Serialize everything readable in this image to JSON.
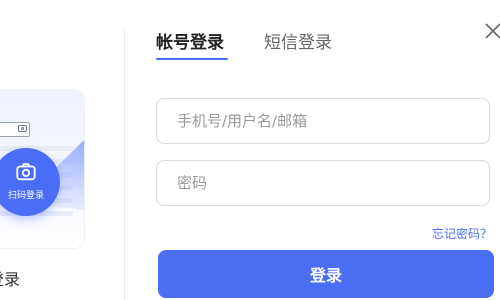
{
  "qr_panel": {
    "scan_label": "扫码登录",
    "bottom_label": "登录"
  },
  "tabs": [
    {
      "label": "帐号登录",
      "active": true
    },
    {
      "label": "短信登录",
      "active": false
    }
  ],
  "form": {
    "account_placeholder": "手机号/用户名/邮箱",
    "account_value": "",
    "password_placeholder": "密码",
    "password_value": "",
    "forgot_label": "忘记密码？",
    "submit_label": "登录"
  },
  "icons": {
    "close": "close-icon",
    "camera": "camera-icon"
  },
  "colors": {
    "accent": "#4a6cf7",
    "button": "#4c6ef5"
  }
}
